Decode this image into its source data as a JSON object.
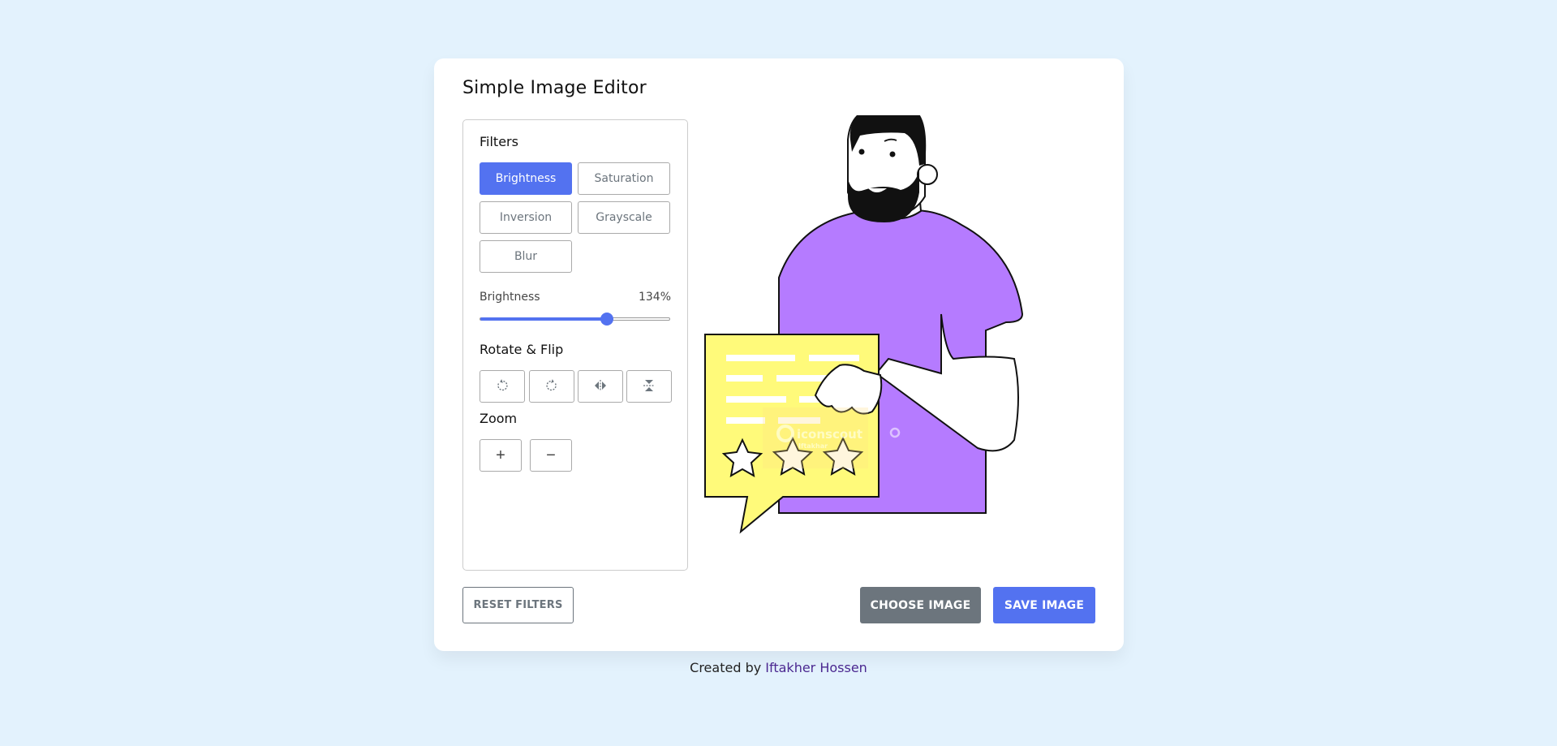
{
  "app": {
    "title": "Simple Image Editor"
  },
  "filters": {
    "heading": "Filters",
    "buttons": [
      "Brightness",
      "Saturation",
      "Inversion",
      "Grayscale",
      "Blur"
    ],
    "active": "Brightness"
  },
  "slider": {
    "name": "Brightness",
    "value_text": "134%",
    "value": 134,
    "max": 200
  },
  "rotate_flip": {
    "heading": "Rotate & Flip",
    "icons": [
      "rotate-left-icon",
      "rotate-right-icon",
      "flip-horizontal-icon",
      "flip-vertical-icon"
    ]
  },
  "zoom": {
    "heading": "Zoom",
    "in_symbol": "+",
    "out_symbol": "−"
  },
  "actions": {
    "reset": "RESET FILTERS",
    "choose": "CHOOSE IMAGE",
    "save": "SAVE IMAGE"
  },
  "preview": {
    "watermark": "iconscout",
    "watermark_sub": "Iftakhar"
  },
  "footer": {
    "prefix": "Created by",
    "author": "Iftakher Hossen"
  },
  "colors": {
    "background": "#e3f2fd",
    "accent": "#5372f0",
    "secondary": "#6c757d",
    "author_link": "#4b2890"
  }
}
